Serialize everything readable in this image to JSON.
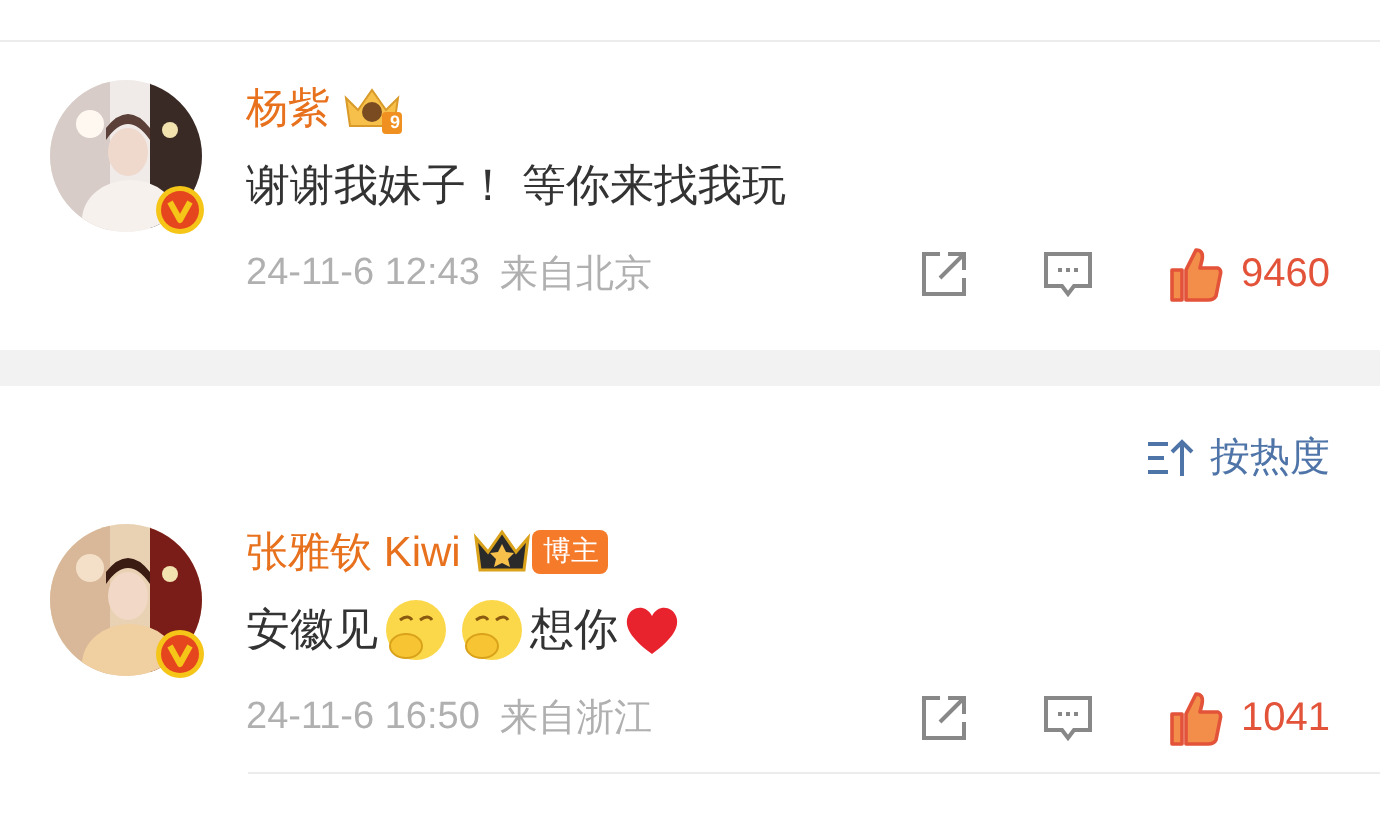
{
  "comments": [
    {
      "name": "杨紫",
      "crown_level": "9",
      "verified": true,
      "avatar": {
        "kind": "picture"
      },
      "content": [
        {
          "kind": "text",
          "text": "谢谢我妹子！ 等你来找我玩"
        }
      ],
      "time": "24-11-6 12:43",
      "location": "来自北京",
      "liked": true,
      "likes": "9460"
    },
    {
      "name": "张雅钦 Kiwi",
      "blogger_tag": "博主",
      "verified": true,
      "avatar": {
        "kind": "picture"
      },
      "content": [
        {
          "kind": "text",
          "text": "安徽见"
        },
        {
          "kind": "emoji"
        },
        {
          "kind": "emoji"
        },
        {
          "kind": "text",
          "text": "想你"
        },
        {
          "kind": "heart"
        }
      ],
      "time": "24-11-6 16:50",
      "location": "来自浙江",
      "liked": true,
      "likes": "1041"
    }
  ],
  "sort": {
    "label": "按热度"
  }
}
